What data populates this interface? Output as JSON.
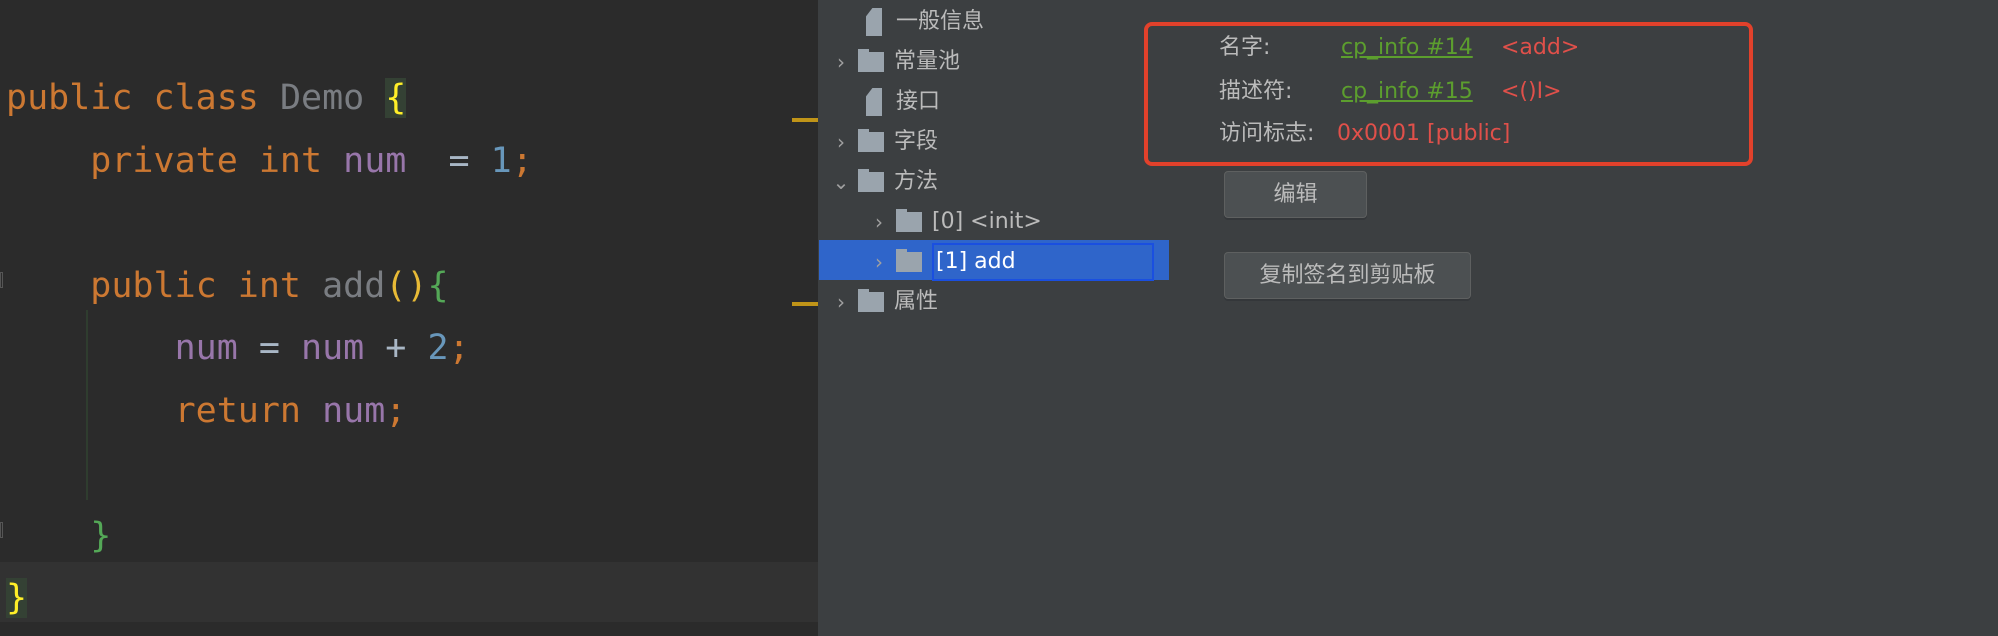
{
  "editor": {
    "lines": [
      {
        "parts": [
          [
            "kw",
            "public class "
          ],
          [
            "cls",
            "Demo "
          ],
          [
            "bry",
            "{"
          ]
        ]
      },
      {
        "parts": [
          [
            "kw",
            "    private int "
          ],
          [
            "fld",
            "num"
          ],
          [
            "",
            "  = "
          ],
          [
            "num",
            "1"
          ],
          [
            "kw",
            ";"
          ]
        ]
      },
      {
        "parts": []
      },
      {
        "parts": [
          [
            "kw",
            "    public int "
          ],
          [
            "fn",
            "add"
          ],
          [
            "par",
            "()"
          ],
          [
            "brg",
            "{"
          ]
        ]
      },
      {
        "parts": [
          [
            "fld",
            "        num"
          ],
          [
            "",
            " = "
          ],
          [
            "fld",
            "num"
          ],
          [
            "",
            " + "
          ],
          [
            "num",
            "2"
          ],
          [
            "kw",
            ";"
          ]
        ]
      },
      {
        "parts": [
          [
            "kw",
            "        return "
          ],
          [
            "fld",
            "num"
          ],
          [
            "kw",
            ";"
          ]
        ]
      },
      {
        "parts": []
      },
      {
        "parts": [
          [
            "brg",
            "    }"
          ]
        ]
      },
      {
        "parts": [
          [
            "bry",
            "}"
          ]
        ]
      }
    ]
  },
  "tree": {
    "items": [
      {
        "label": "一般信息",
        "icon": "file-icon",
        "chevron": ""
      },
      {
        "label": "常量池",
        "icon": "folder-icon",
        "chevron": "›"
      },
      {
        "label": "接口",
        "icon": "file-icon",
        "chevron": ""
      },
      {
        "label": "字段",
        "icon": "folder-icon",
        "chevron": "›"
      },
      {
        "label": "方法",
        "icon": "folder-icon",
        "chevron": "⌄"
      },
      {
        "label": "[0] <init>",
        "icon": "folder-icon",
        "chevron": "›",
        "child": true
      },
      {
        "label": "[1] add",
        "icon": "folder-icon",
        "chevron": "›",
        "child": true,
        "selected": true
      },
      {
        "label": "属性",
        "icon": "folder-icon",
        "chevron": "›"
      }
    ]
  },
  "info": {
    "name_label": "名字:",
    "name_link": "cp_info #14",
    "name_value": "<add>",
    "desc_label": "描述符:",
    "desc_link": "cp_info #15",
    "desc_value": "<()I>",
    "access_label": "访问标志:",
    "access_value": "0x0001 [public]"
  },
  "buttons": {
    "edit": "编辑",
    "copy_signature": "复制签名到剪贴板"
  },
  "colors": {
    "selection": "#2f65ca",
    "highlight_box": "#e2412b",
    "link": "#5c9e2e",
    "value": "#e0504a"
  }
}
